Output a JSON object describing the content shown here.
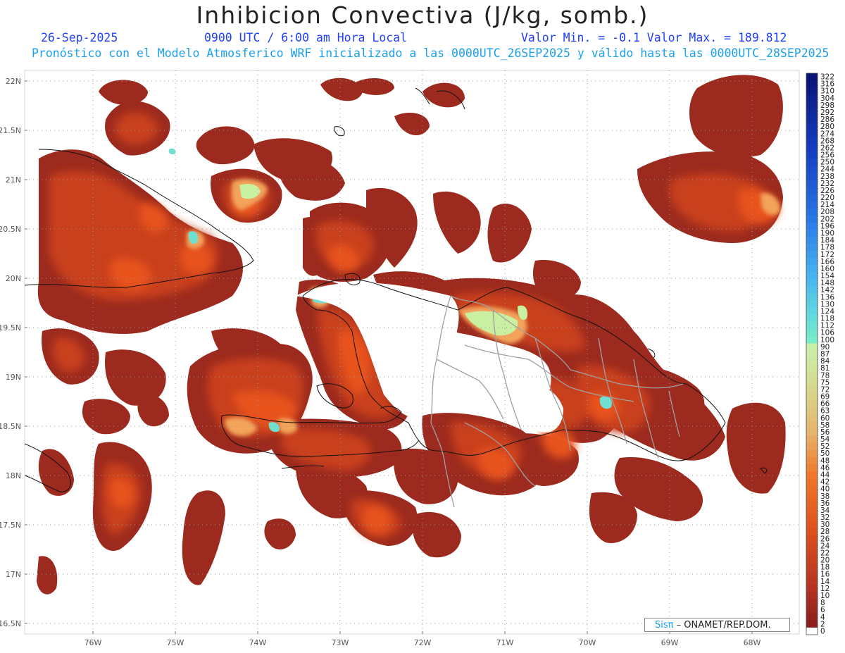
{
  "header": {
    "title": "Inhibicion Convectiva (J/kg, somb.)",
    "date": "26-Sep-2025",
    "time": "0900 UTC / 6:00 am Hora Local",
    "minmax": "Valor Min. = -0.1  Valor Max. = 189.812",
    "subtitle": "Pronóstico con el Modelo Atmosferico WRF inicializado a las 0000UTC_26SEP2025 y válido hasta las  0000UTC_28SEP2025"
  },
  "map": {
    "lat_labels": [
      "22N",
      "21.5N",
      "21N",
      "20.5N",
      "20N",
      "19.5N",
      "19N",
      "18.5N",
      "18N",
      "17.5N",
      "17N",
      "16.5N"
    ],
    "lon_labels": [
      "76W",
      "75W",
      "74W",
      "73W",
      "72W",
      "71W",
      "70W",
      "69W",
      "68W"
    ],
    "fill_colors": {
      "dark": "#9c2a1e",
      "mid": "#c9401e",
      "orange": "#e8531a",
      "light": "#f08a3a",
      "cyan": "#6fe0d0",
      "lime": "#c8f0a0"
    },
    "coast_color": "#111111",
    "border_color": "#a0a0a0"
  },
  "colorbar": {
    "labels": [
      "322",
      "316",
      "310",
      "304",
      "298",
      "292",
      "286",
      "280",
      "274",
      "268",
      "262",
      "256",
      "250",
      "244",
      "238",
      "232",
      "226",
      "220",
      "214",
      "208",
      "202",
      "196",
      "190",
      "184",
      "178",
      "172",
      "166",
      "160",
      "154",
      "148",
      "142",
      "136",
      "130",
      "124",
      "118",
      "112",
      "106",
      "100",
      "90",
      "87",
      "84",
      "81",
      "78",
      "75",
      "72",
      "69",
      "66",
      "63",
      "60",
      "58",
      "56",
      "54",
      "52",
      "50",
      "48",
      "46",
      "44",
      "42",
      "40",
      "38",
      "36",
      "34",
      "32",
      "30",
      "28",
      "26",
      "24",
      "22",
      "20",
      "18",
      "16",
      "14",
      "12",
      "10",
      "8",
      "6",
      "4",
      "2",
      "0"
    ]
  },
  "credit": {
    "brand": "Sisπ",
    "text": " – ONAMET/REP.DOM."
  }
}
